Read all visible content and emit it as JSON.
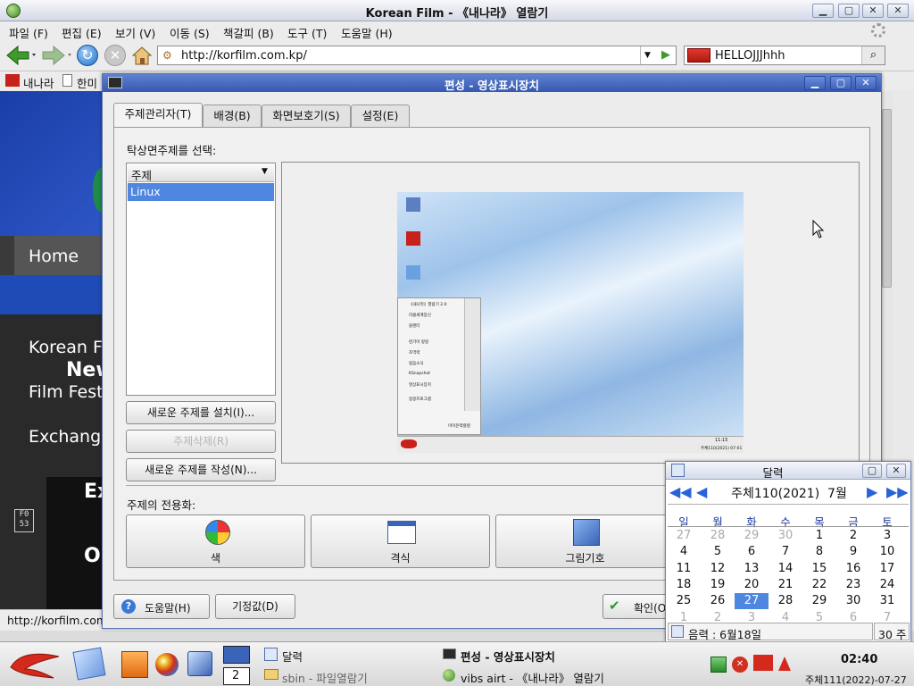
{
  "browser": {
    "title": "Korean Film - 《내나라》 열람기",
    "menu": [
      "파일 (F)",
      "편집 (E)",
      "보기 (V)",
      "이동 (S)",
      "책갈피 (B)",
      "도구 (T)",
      "도움말 (H)"
    ],
    "url": "http://korfilm.com.kp/",
    "search_value": "HELLOJJJhhh",
    "bookmarks": [
      "내나라",
      "한미"
    ],
    "status_url": "http://korfilm.com",
    "page": {
      "home": "Home",
      "text1": "Korean F",
      "text2": "New",
      "text3": "Film Fest",
      "text4": "Exchange",
      "text5": "Ex",
      "text6": "O",
      "badge_l1": "F0",
      "badge_l2": "53"
    }
  },
  "dialog": {
    "title": "편성 - 영상표시장치",
    "tabs": [
      "주제관리자(T)",
      "배경(B)",
      "화면보호기(S)",
      "설정(E)"
    ],
    "select_label": "탁상면주제를 선택:",
    "theme_column_header": "주제",
    "themes": [
      "Linux"
    ],
    "install_button": "새로운 주제를 설치(I)...",
    "delete_button": "주제삭제(R)",
    "create_button": "새로운 주제를 작성(N)...",
    "customize_label": "주제의 전용화:",
    "customize_items": [
      {
        "label": "색",
        "icon": "color-icon"
      },
      {
        "label": "격식",
        "icon": "style-icon"
      },
      {
        "label": "그림기호",
        "icon": "icons-icon"
      }
    ],
    "help_button": "도움말(H)",
    "defaults_button": "기정값(D)",
    "ok_button": "확인(O)",
    "preview": {
      "menu_items": [
        "《내나라》열람기 2.0",
        "리콜세계장신",
        "블랜터",
        "련기아 랑랑",
        "조역력",
        "림음소식",
        "KSnapshot",
        "영상표시장치",
        "봉봉프로그램"
      ],
      "login_label": "미미문력렬렬",
      "clock_time": "11:15",
      "clock_date": "주체110(2021) 07-01"
    }
  },
  "calendar": {
    "title": "달력",
    "month_label": "주체110(2021)  7월",
    "weekdays": [
      "일",
      "월",
      "화",
      "수",
      "목",
      "금",
      "토"
    ],
    "days": [
      [
        "27",
        "28",
        "29",
        "30",
        "1",
        "2",
        "3"
      ],
      [
        "4",
        "5",
        "6",
        "7",
        "8",
        "9",
        "10"
      ],
      [
        "11",
        "12",
        "13",
        "14",
        "15",
        "16",
        "17"
      ],
      [
        "18",
        "19",
        "20",
        "21",
        "22",
        "23",
        "24"
      ],
      [
        "25",
        "26",
        "27",
        "28",
        "29",
        "30",
        "31"
      ],
      [
        "1",
        "2",
        "3",
        "4",
        "5",
        "6",
        "7"
      ]
    ],
    "selected_day": "27",
    "lunar_label": "음력 : 6월18일",
    "week_label": "30 주"
  },
  "taskbar": {
    "desktop_number": "2",
    "tasks": [
      "달력",
      "sbin - 파일열람기",
      "편성 - 영상표시장치",
      "vibs airt - 《내나라》 열람기"
    ],
    "clock_time": "02:40",
    "clock_date": "주체111(2022)-07-27"
  },
  "colors": {
    "accent": "#3658b0",
    "selected": "#4f86e0",
    "weekend": "#1d3a9b",
    "sunday": "#c00000"
  }
}
